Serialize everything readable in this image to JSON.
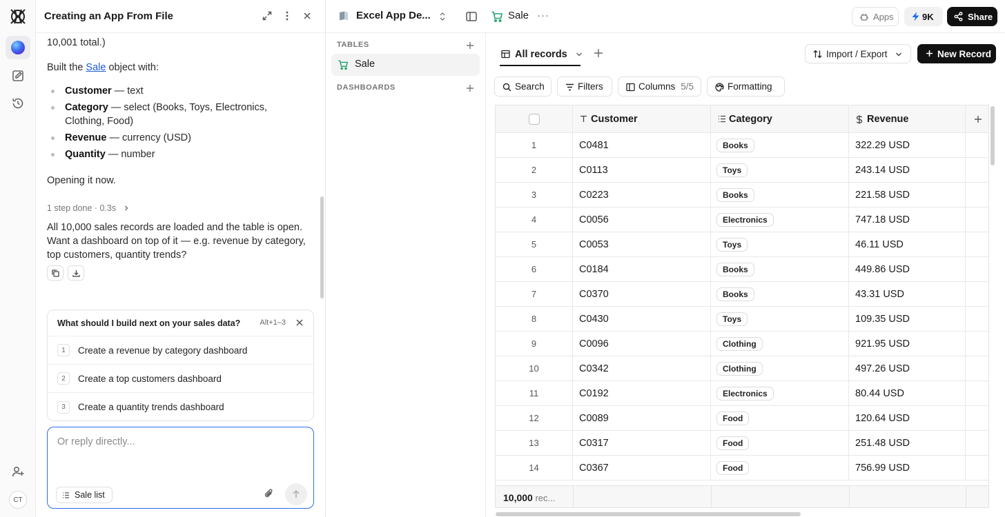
{
  "chat": {
    "title": "Creating an App From File",
    "intro_tail": "10,001 total.)",
    "built_prefix": "Built the ",
    "built_link": "Sale",
    "built_suffix": " object with:",
    "fields": [
      {
        "name": "Customer",
        "desc": " — text"
      },
      {
        "name": "Category",
        "desc": " — select (Books, Toys, Electronics, Clothing, Food)"
      },
      {
        "name": "Revenue",
        "desc": " — currency (USD)"
      },
      {
        "name": "Quantity",
        "desc": " — number"
      }
    ],
    "opening": "Opening it now.",
    "steps": "1 step done · 0.3s",
    "summary": "All 10,000 sales records are loaded and the table is open. Want a dashboard on top of it — e.g. revenue by category, top customers, quantity trends?"
  },
  "suggestions": {
    "question": "What should I build next on your sales data?",
    "shortcut": "Alt+1–3",
    "items": [
      {
        "num": "1",
        "label": "Create a revenue by category dashboard"
      },
      {
        "num": "2",
        "label": "Create a top customers dashboard"
      },
      {
        "num": "3",
        "label": "Create a quantity trends dashboard"
      }
    ]
  },
  "reply": {
    "placeholder": "Or reply directly...",
    "context_chip": "Sale list"
  },
  "user": {
    "initials": "CT"
  },
  "topbar": {
    "app_name": "Excel App De...",
    "tab_name": "Sale",
    "tab_more": "···",
    "apps_label": "Apps",
    "credits_label": "9K",
    "share_label": "Share"
  },
  "sidebar": {
    "tables_label": "TABLES",
    "tables": [
      "Sale"
    ],
    "dashboards_label": "DASHBOARDS"
  },
  "view": {
    "name": "All records",
    "import_export": "Import / Export",
    "new_record": "New Record",
    "search": "Search",
    "filters": "Filters",
    "columns": "Columns",
    "columns_count": "5/5",
    "formatting": "Formatting"
  },
  "table": {
    "columns": [
      "Customer",
      "Category",
      "Revenue"
    ],
    "rows": [
      {
        "n": "1",
        "customer": "C0481",
        "category": "Books",
        "revenue": "322.29 USD"
      },
      {
        "n": "2",
        "customer": "C0113",
        "category": "Toys",
        "revenue": "243.14 USD"
      },
      {
        "n": "3",
        "customer": "C0223",
        "category": "Books",
        "revenue": "221.58 USD"
      },
      {
        "n": "4",
        "customer": "C0056",
        "category": "Electronics",
        "revenue": "747.18 USD"
      },
      {
        "n": "5",
        "customer": "C0053",
        "category": "Toys",
        "revenue": "46.11 USD"
      },
      {
        "n": "6",
        "customer": "C0184",
        "category": "Books",
        "revenue": "449.86 USD"
      },
      {
        "n": "7",
        "customer": "C0370",
        "category": "Books",
        "revenue": "43.31 USD"
      },
      {
        "n": "8",
        "customer": "C0430",
        "category": "Toys",
        "revenue": "109.35 USD"
      },
      {
        "n": "9",
        "customer": "C0096",
        "category": "Clothing",
        "revenue": "921.95 USD"
      },
      {
        "n": "10",
        "customer": "C0342",
        "category": "Clothing",
        "revenue": "497.26 USD"
      },
      {
        "n": "11",
        "customer": "C0192",
        "category": "Electronics",
        "revenue": "80.44 USD"
      },
      {
        "n": "12",
        "customer": "C0089",
        "category": "Food",
        "revenue": "120.64 USD"
      },
      {
        "n": "13",
        "customer": "C0317",
        "category": "Food",
        "revenue": "251.48 USD"
      },
      {
        "n": "14",
        "customer": "C0367",
        "category": "Food",
        "revenue": "756.99 USD"
      }
    ],
    "record_count": "10,000",
    "record_suffix": " rec..."
  },
  "colors": {
    "accent": "#2d6bf0",
    "link": "#1e5bd8",
    "cart_green": "#22a06b",
    "dark": "#111111"
  },
  "icons": {
    "rail": [
      "app-logo-icon",
      "ai-orb-icon",
      "edit-icon",
      "history-icon",
      "add-user-icon"
    ],
    "chat_header": [
      "expand-icon",
      "more-vertical-icon",
      "close-icon"
    ],
    "topbar": [
      "book-icon",
      "chevron-updown-icon",
      "sidebar-toggle-icon",
      "cart-icon",
      "apps-icon",
      "bolt-icon",
      "share-icon"
    ]
  }
}
